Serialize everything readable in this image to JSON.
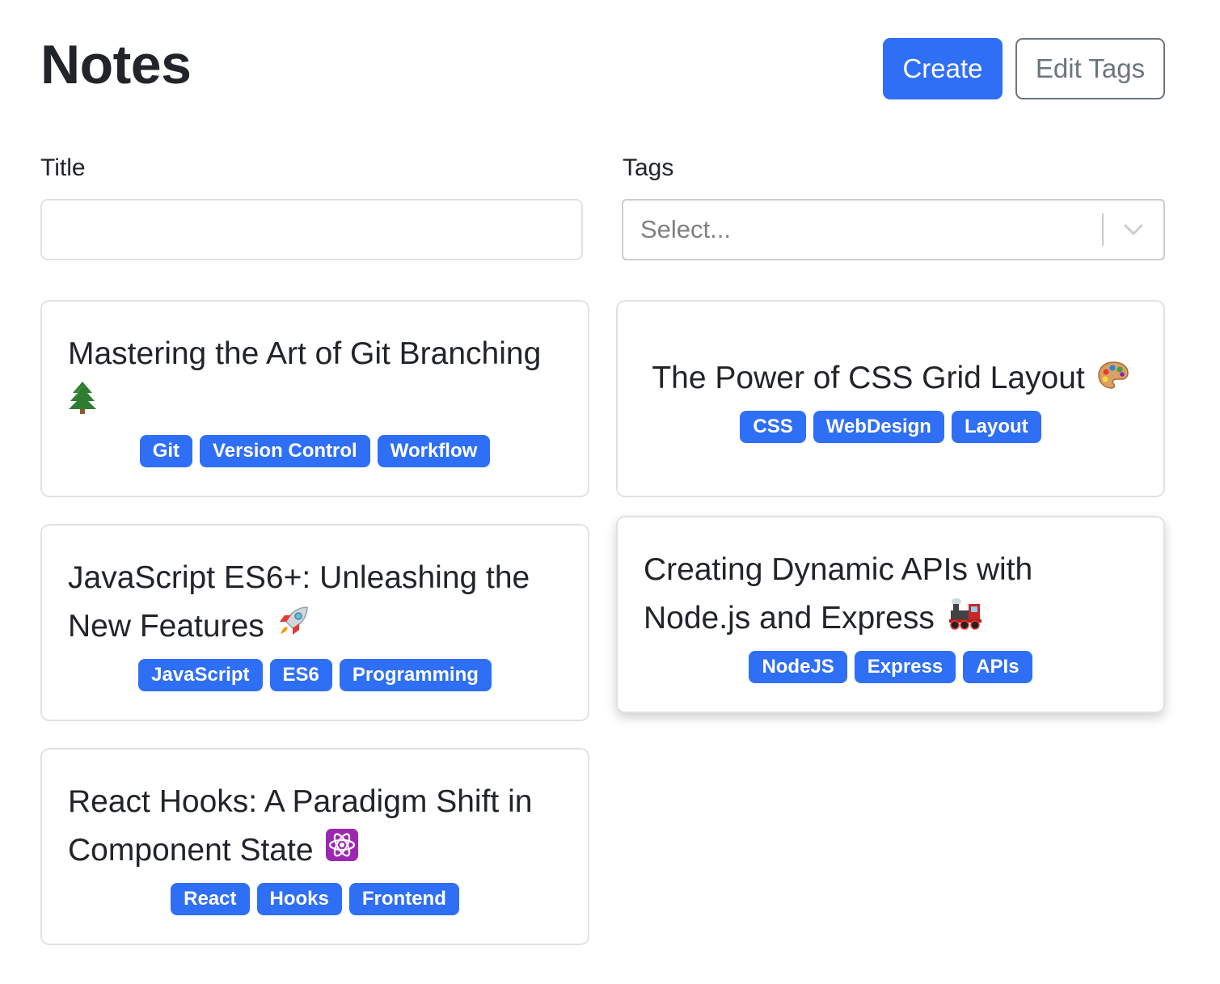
{
  "page": {
    "title": "Notes"
  },
  "actions": {
    "create_label": "Create",
    "edit_tags_label": "Edit Tags"
  },
  "filters": {
    "title_label": "Title",
    "title_value": "",
    "tags_label": "Tags",
    "tags_placeholder": "Select..."
  },
  "notes": [
    {
      "title": "Mastering the Art of Git Branching",
      "emoji_icon": "tree-icon",
      "tags": [
        "Git",
        "Version Control",
        "Workflow"
      ]
    },
    {
      "title": "The Power of CSS Grid Layout",
      "emoji_icon": "palette-icon",
      "tags": [
        "CSS",
        "WebDesign",
        "Layout"
      ]
    },
    {
      "title": "JavaScript ES6+: Unleashing the New Features",
      "emoji_icon": "rocket-icon",
      "tags": [
        "JavaScript",
        "ES6",
        "Programming"
      ]
    },
    {
      "title": "Creating Dynamic APIs with Node.js and Express",
      "emoji_icon": "locomotive-icon",
      "tags": [
        "NodeJS",
        "Express",
        "APIs"
      ]
    },
    {
      "title": "React Hooks: A Paradigm Shift in Component State",
      "emoji_icon": "atom-icon",
      "tags": [
        "React",
        "Hooks",
        "Frontend"
      ]
    }
  ],
  "colors": {
    "primary": "#2f6ff6",
    "secondary": "#6c757d",
    "border": "#dee2e6",
    "text": "#212529"
  }
}
